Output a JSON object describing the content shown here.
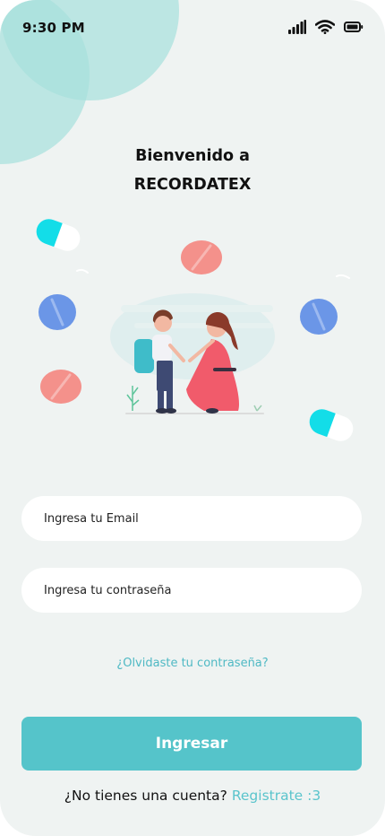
{
  "status_bar": {
    "time": "9:30 PM",
    "icons": [
      "signal-icon",
      "wifi-icon",
      "battery-icon"
    ]
  },
  "header": {
    "line1": "Bienvenido a",
    "line2": "RECORDATEX"
  },
  "illustration": {
    "subject": "mother-and-child-illustration",
    "decorations": [
      "capsule-pill-icon",
      "round-pill-icon"
    ]
  },
  "form": {
    "email_placeholder": "Ingresa tu Email",
    "password_placeholder": "Ingresa tu contraseña",
    "forgot_label": "¿Olvidaste tu contraseña?",
    "submit_label": "Ingresar"
  },
  "signup": {
    "prompt": "¿No tienes una cuenta?",
    "link_label": "Registrate :3"
  },
  "colors": {
    "background": "#eff3f2",
    "accent": "#55c4ca",
    "link": "#4fb9c4",
    "blob": "#a8e0dc",
    "pill_pink": "#f47f79",
    "pill_blue": "#5c8ce6",
    "capsule_cyan": "#13dde8"
  }
}
